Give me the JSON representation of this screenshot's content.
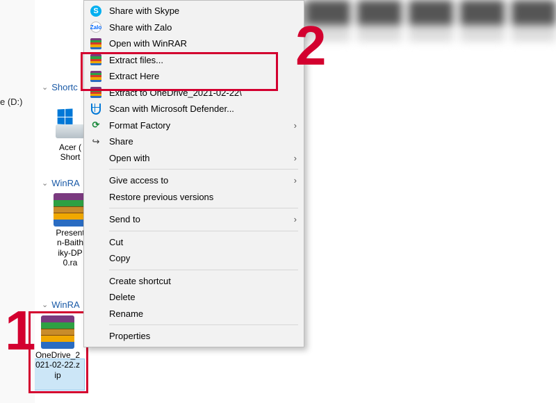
{
  "sidebar": {
    "drive_label": "e (D:)"
  },
  "groups": {
    "shortcuts": "Shortc",
    "winrar1": "WinRA",
    "winrar2": "WinRA"
  },
  "files": {
    "acer": "Acer (\nShort",
    "present": "Present\nn-Baith\niky-DP\n0.ra",
    "onedrive": "OneDrive_2\n021-02-22.z\nip"
  },
  "annotations": {
    "step1": "1",
    "step2": "2"
  },
  "menu": [
    {
      "icon": "skype",
      "label": "Share with Skype",
      "arrow": false
    },
    {
      "icon": "zalo",
      "label": "Share with Zalo",
      "arrow": false
    },
    {
      "icon": "rar",
      "label": "Open with WinRAR",
      "arrow": false
    },
    {
      "icon": "rar",
      "label": "Extract files...",
      "arrow": false
    },
    {
      "icon": "rar",
      "label": "Extract Here",
      "arrow": false
    },
    {
      "icon": "rar",
      "label": "Extract to OneDrive_2021-02-22\\",
      "arrow": false
    },
    {
      "icon": "shield",
      "label": "Scan with Microsoft Defender...",
      "arrow": false
    },
    {
      "icon": "ff",
      "label": "Format Factory",
      "arrow": true
    },
    {
      "icon": "share",
      "label": "Share",
      "arrow": false
    },
    {
      "icon": "",
      "label": "Open with",
      "arrow": true
    },
    {
      "sep": true
    },
    {
      "icon": "",
      "label": "Give access to",
      "arrow": true
    },
    {
      "icon": "",
      "label": "Restore previous versions",
      "arrow": false
    },
    {
      "sep": true
    },
    {
      "icon": "",
      "label": "Send to",
      "arrow": true
    },
    {
      "sep": true
    },
    {
      "icon": "",
      "label": "Cut",
      "arrow": false
    },
    {
      "icon": "",
      "label": "Copy",
      "arrow": false
    },
    {
      "sep": true
    },
    {
      "icon": "",
      "label": "Create shortcut",
      "arrow": false
    },
    {
      "icon": "",
      "label": "Delete",
      "arrow": false
    },
    {
      "icon": "",
      "label": "Rename",
      "arrow": false
    },
    {
      "sep": true
    },
    {
      "icon": "",
      "label": "Properties",
      "arrow": false
    }
  ],
  "colors": {
    "highlight_border": "#d3002f",
    "selection_bg": "#cce6f7"
  }
}
